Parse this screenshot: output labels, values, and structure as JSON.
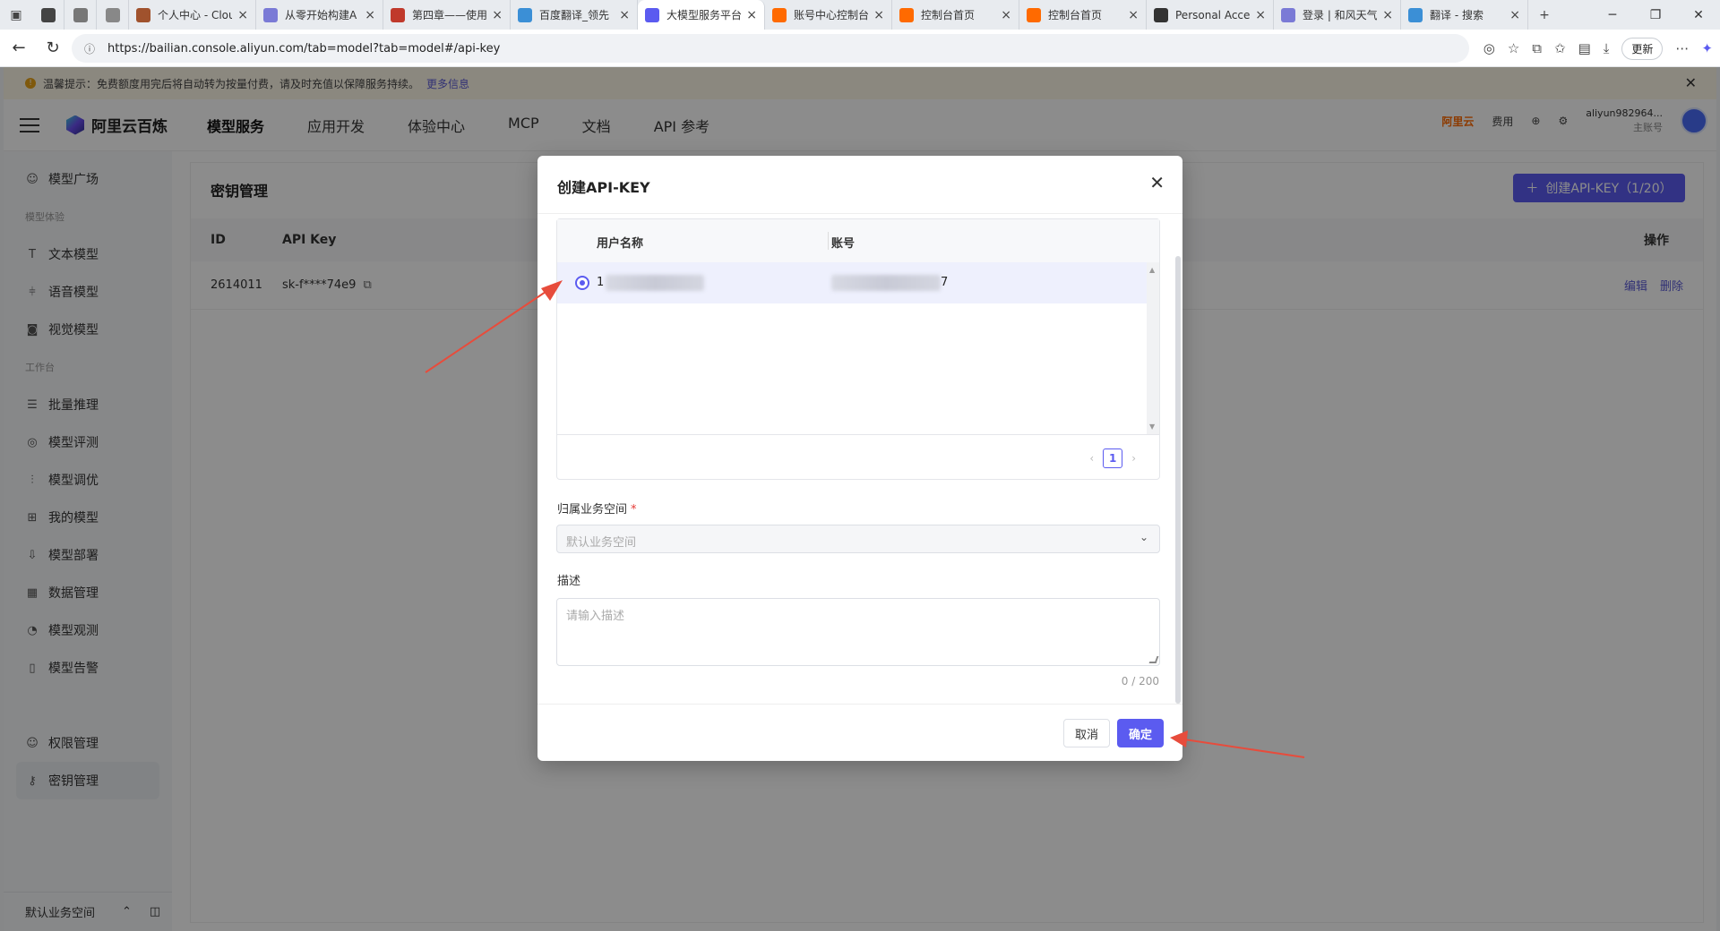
{
  "browser": {
    "tabs": [
      {
        "title": "",
        "color": "#444"
      },
      {
        "title": "",
        "color": "#777"
      },
      {
        "title": "",
        "color": "#888"
      },
      {
        "title": "个人中心 - Clou",
        "color": "#a0522d"
      },
      {
        "title": "从零开始构建A",
        "color": "#7a7ad6"
      },
      {
        "title": "第四章——使用",
        "color": "#c0392b"
      },
      {
        "title": "百度翻译_领先",
        "color": "#3b8fd6"
      },
      {
        "title": "大模型服务平台",
        "color": "#5b5bf0",
        "active": true
      },
      {
        "title": "账号中心控制台",
        "color": "#ff6a00"
      },
      {
        "title": "控制台首页",
        "color": "#ff6a00"
      },
      {
        "title": "控制台首页",
        "color": "#ff6a00"
      },
      {
        "title": "Personal Acces",
        "color": "#333"
      },
      {
        "title": "登录 | 和风天气",
        "color": "#7a7ad6"
      },
      {
        "title": "翻译 - 搜索",
        "color": "#3b8fd6"
      }
    ],
    "url": "https://bailian.console.aliyun.com/tab=model?tab=model#/api-key",
    "update_label": "更新"
  },
  "notice": {
    "text": "温馨提示：免费额度用完后将自动转为按量付费，请及时充值以保障服务持续。",
    "link": "更多信息"
  },
  "topnav": {
    "brand": "阿里云百炼",
    "items": [
      "模型服务",
      "应用开发",
      "体验中心",
      "MCP",
      "文档",
      "API 参考"
    ],
    "aliyun": "阿里云",
    "fee": "费用",
    "user_name": "aliyun982964...",
    "user_role": "主账号"
  },
  "sidebar": {
    "top_item": "模型广场",
    "group1": "模型体验",
    "group1_items": [
      "文本模型",
      "语音模型",
      "视觉模型"
    ],
    "group2": "工作台",
    "group2_items": [
      "批量推理",
      "模型评测",
      "模型调优",
      "我的模型",
      "模型部署",
      "数据管理",
      "模型观测",
      "模型告警"
    ],
    "bottom_items": [
      "权限管理",
      "密钥管理"
    ],
    "workspace": "默认业务空间"
  },
  "content": {
    "title": "密钥管理",
    "create_button": "创建API-KEY（1/20）",
    "headers": {
      "id": "ID",
      "api_key": "API Key",
      "actions": "操作"
    },
    "row": {
      "id": "2614011",
      "api_key": "sk-f****74e9",
      "edit": "编辑",
      "delete": "删除"
    }
  },
  "modal": {
    "title": "创建API-KEY",
    "table_headers": {
      "username": "用户名称",
      "account": "账号"
    },
    "row": {
      "username_prefix": "1",
      "account_suffix": "7"
    },
    "page": "1",
    "workspace_label": "归属业务空间",
    "workspace_required": "*",
    "workspace_placeholder": "默认业务空间",
    "desc_label": "描述",
    "desc_placeholder": "请输入描述",
    "desc_counter": "0 / 200",
    "cancel": "取消",
    "confirm": "确定"
  },
  "colors": {
    "accent": "#5b5bf0",
    "arrow": "#e74c3c",
    "warning": "#e8a317"
  }
}
